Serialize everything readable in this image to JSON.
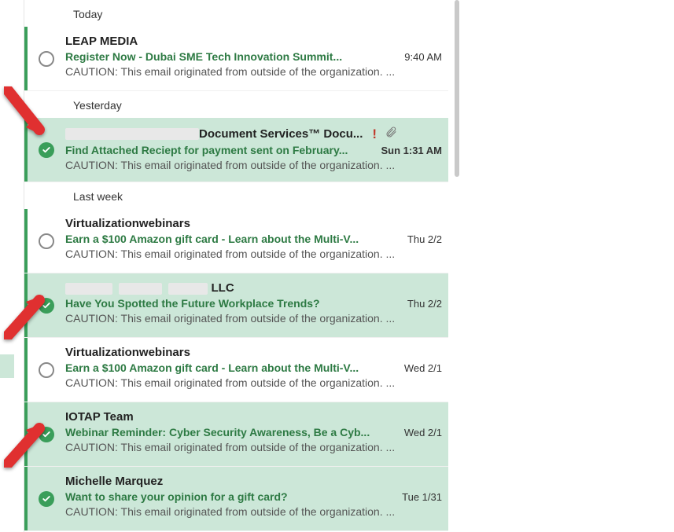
{
  "groups": {
    "today": "Today",
    "yesterday": "Yesterday",
    "lastweek": "Last week"
  },
  "caution": "CAUTION: This email originated from outside of the organization. ...",
  "items": {
    "m0": {
      "sender": "LEAP MEDIA",
      "subject": "Register Now - Dubai SME Tech Innovation Summit...",
      "time": "9:40 AM"
    },
    "m1": {
      "sender_suffix": "Document Services™ Docu...",
      "subject": "Find Attached Reciept for payment sent on February...",
      "time": "Sun 1:31 AM"
    },
    "m2": {
      "sender": "Virtualizationwebinars",
      "subject": "Earn a $100 Amazon gift card - Learn about the Multi-V...",
      "time": "Thu 2/2"
    },
    "m3": {
      "sender_suffix": " LLC",
      "subject": "Have You Spotted the Future Workplace Trends?",
      "time": "Thu 2/2"
    },
    "m4": {
      "sender": "Virtualizationwebinars",
      "subject": "Earn a $100 Amazon gift card - Learn about the Multi-V...",
      "time": "Wed 2/1"
    },
    "m5": {
      "sender": "IOTAP Team",
      "subject": "Webinar Reminder: Cyber Security Awareness, Be a Cyb...",
      "time": "Wed 2/1"
    },
    "m6": {
      "sender": "Michelle Marquez",
      "subject": "Want to share your opinion for a gift card?",
      "time": "Tue 1/31"
    }
  }
}
